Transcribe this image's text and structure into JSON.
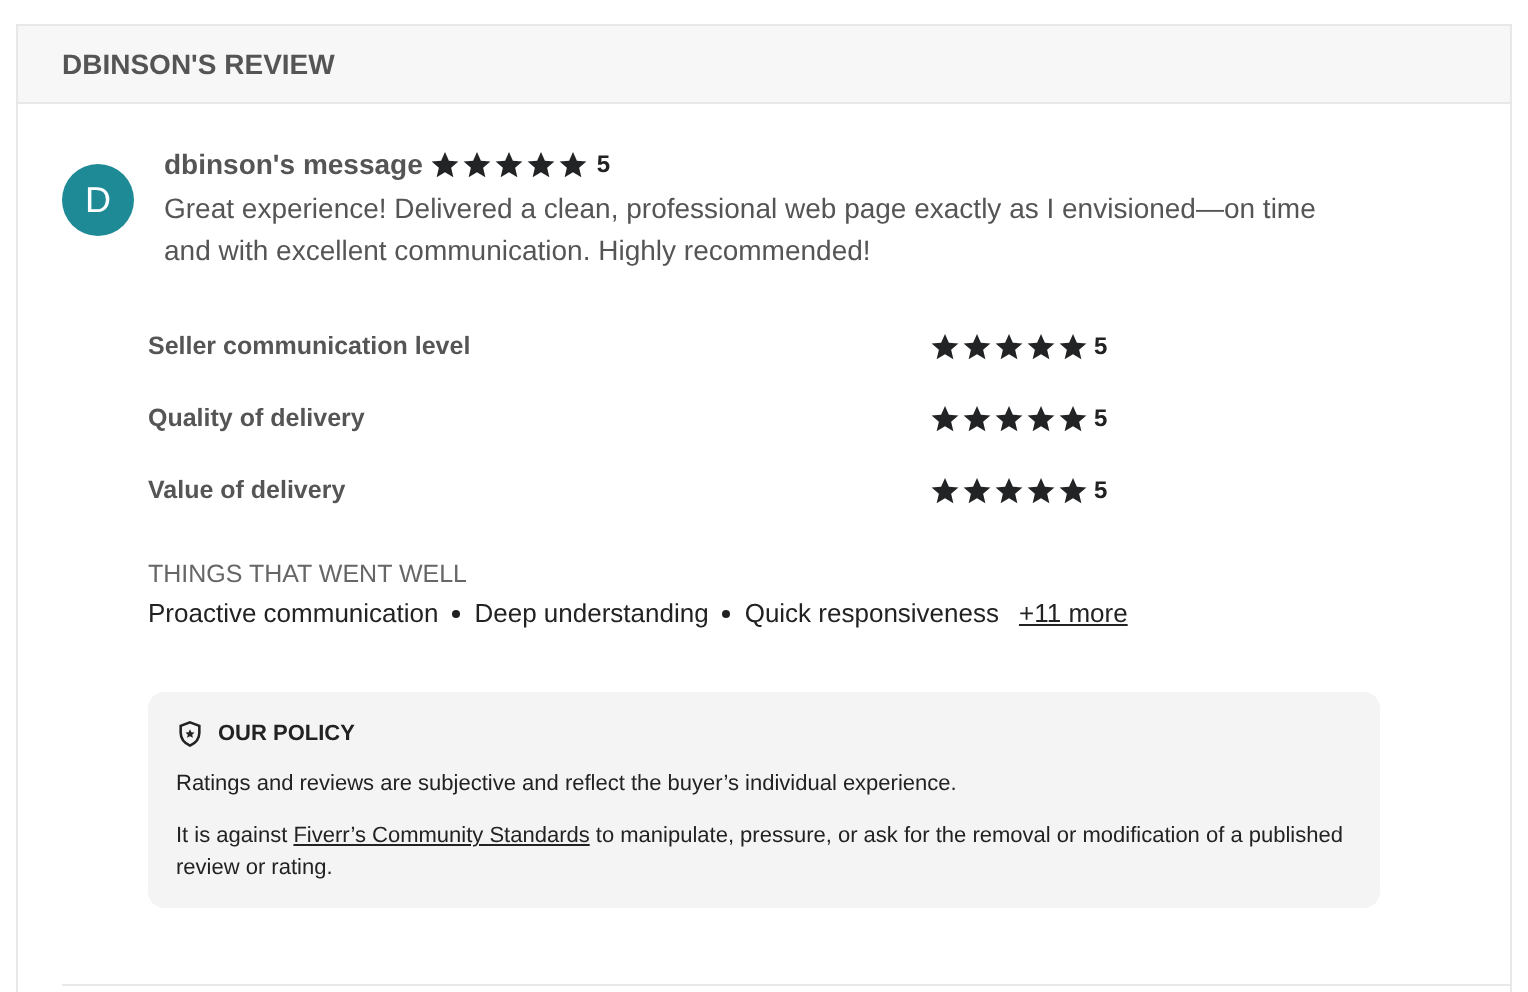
{
  "header": {
    "title": "DBINSON'S REVIEW"
  },
  "review": {
    "avatar_letter": "D",
    "author": "dbinson's message",
    "stars": 5,
    "score": "5",
    "message": "Great experience! Delivered a clean, professional web page exactly as I envisioned—on time and with excellent communication. Highly recommended!"
  },
  "ratings": [
    {
      "label": "Seller communication level",
      "stars": 5,
      "score": "5"
    },
    {
      "label": "Quality of delivery",
      "stars": 5,
      "score": "5"
    },
    {
      "label": "Value of delivery",
      "stars": 5,
      "score": "5"
    }
  ],
  "highlights": {
    "title": "THINGS THAT WENT WELL",
    "items": [
      "Proactive communication",
      "Deep understanding",
      "Quick responsiveness"
    ],
    "more_link": "+11 more"
  },
  "policy": {
    "title": "OUR POLICY",
    "paragraph_1": "Ratings and reviews are subjective and reflect the buyer’s individual experience.",
    "paragraph_2_before": "It is against",
    "paragraph_2_link": "Fiverr’s Community Standards",
    "paragraph_2_after": "to manipulate, pressure, or ask for the removal or modification of a published review or rating."
  }
}
